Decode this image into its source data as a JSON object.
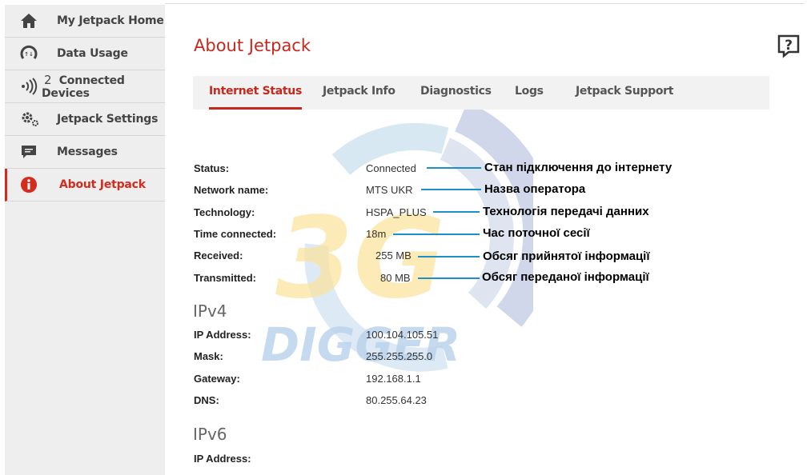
{
  "sidebar": {
    "items": [
      {
        "label": "My Jetpack Home",
        "icon": "home-icon"
      },
      {
        "label": "Data Usage",
        "icon": "data-usage-icon"
      },
      {
        "label": "Connected Devices",
        "icon": "wifi-signal-icon",
        "count": "2"
      },
      {
        "label": "Jetpack Settings",
        "icon": "gear-icon"
      },
      {
        "label": "Messages",
        "icon": "message-icon"
      },
      {
        "label": "About Jetpack",
        "icon": "info-icon",
        "active": true
      }
    ]
  },
  "header": {
    "title": "About Jetpack",
    "help_icon": "help-icon"
  },
  "tabs": [
    {
      "label": "Internet Status",
      "active": true
    },
    {
      "label": "Jetpack Info"
    },
    {
      "label": "Diagnostics"
    },
    {
      "label": "Logs"
    },
    {
      "label": "Jetpack Support"
    }
  ],
  "status": {
    "rows": [
      {
        "key": "Status:",
        "value": "Connected"
      },
      {
        "key": "Network name:",
        "value": "MTS UKR"
      },
      {
        "key": "Technology:",
        "value": "HSPA_PLUS"
      },
      {
        "key": "Time connected:",
        "value": "18m"
      },
      {
        "key": "Received:",
        "value": "255 MB"
      },
      {
        "key": "Transmitted:",
        "value": "80 MB"
      }
    ]
  },
  "ipv4": {
    "heading": "IPv4",
    "rows": [
      {
        "key": "IP Address:",
        "value": "100.104.105.51"
      },
      {
        "key": "Mask:",
        "value": "255.255.255.0"
      },
      {
        "key": "Gateway:",
        "value": "192.168.1.1"
      },
      {
        "key": "DNS:",
        "value": "80.255.64.23"
      }
    ]
  },
  "ipv6": {
    "heading": "IPv6",
    "rows": [
      {
        "key": "IP Address:",
        "value": ""
      }
    ]
  },
  "annotations": [
    "Стан підключення до інтернету",
    "Назва оператора",
    "Технологія передачі данних",
    "Час поточної сесії",
    "Обсяг прийнятої інформації",
    "Обсяг переданої інформації"
  ],
  "watermark": {
    "top": "3G",
    "bottom": "DIGGER"
  },
  "colors": {
    "accent": "#c8281c",
    "callout": "#1f8fc7",
    "sidebar_bg": "#eeeeee",
    "tab_bg": "#f2f2f2"
  }
}
